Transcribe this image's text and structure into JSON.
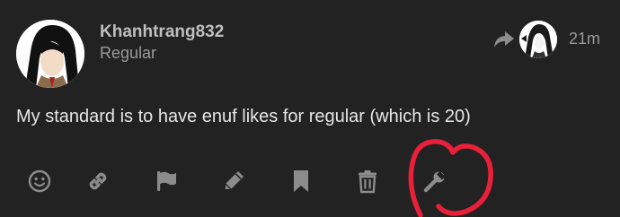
{
  "post": {
    "username": "Khanhtrang832",
    "user_title": "Regular",
    "time_ago": "21m",
    "body": "My standard is to have enuf likes for regular (which is 20)"
  },
  "actions": [
    {
      "name": "like-button",
      "icon": "smile-icon"
    },
    {
      "name": "copy-link-button",
      "icon": "link-icon"
    },
    {
      "name": "flag-button",
      "icon": "flag-icon"
    },
    {
      "name": "edit-button",
      "icon": "pencil-icon"
    },
    {
      "name": "bookmark-button",
      "icon": "bookmark-icon"
    },
    {
      "name": "delete-button",
      "icon": "trash-icon"
    },
    {
      "name": "admin-button",
      "icon": "wrench-icon"
    }
  ],
  "colors": {
    "background": "#222222",
    "icon": "#8c8c8c",
    "annotation": "#e8203a"
  }
}
